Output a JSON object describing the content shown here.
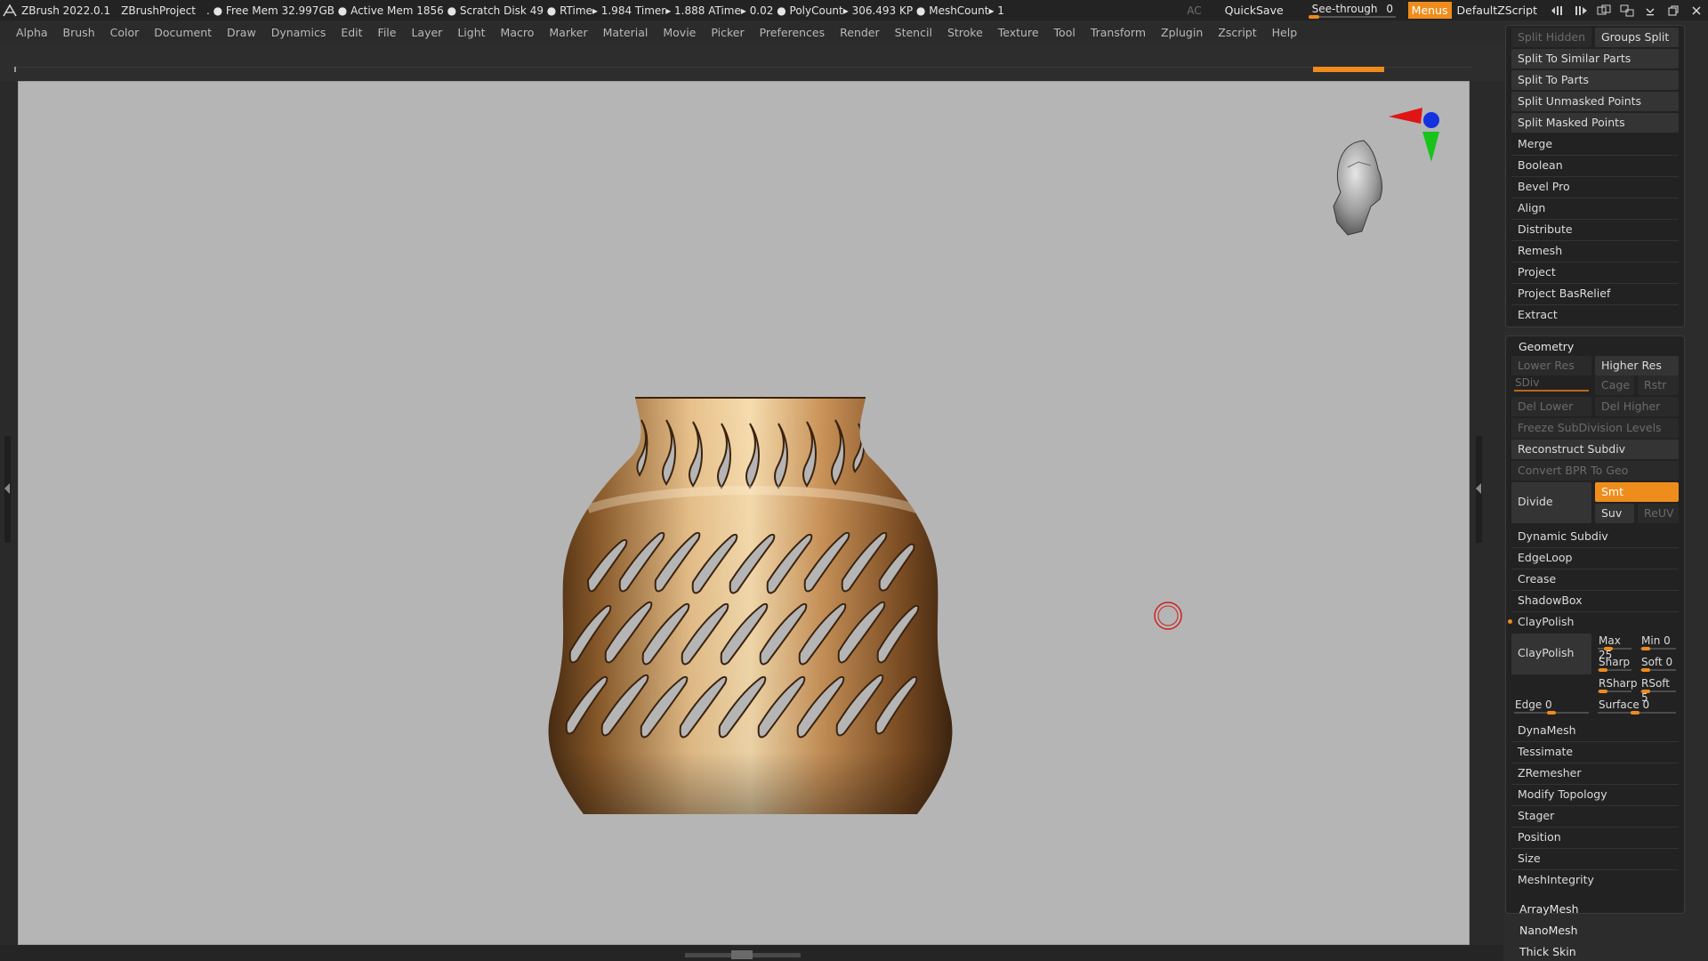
{
  "titlebar": {
    "app": "ZBrush 2022.0.1",
    "project": "ZBrushProject",
    "status": ". ● Free Mem 32.997GB ● Active Mem 1856 ● Scratch Disk 49 ● RTime▸ 1.984 Timer▸ 1.888 ATime▸ 0.02 ● PolyCount▸ 306.493 KP ● MeshCount▸ 1",
    "ac": "AC",
    "quicksave": "QuickSave",
    "see_through_label": "See-through",
    "see_through_value": "0",
    "menus": "Menus",
    "default_zscript": "DefaultZScript"
  },
  "menubar": [
    "Alpha",
    "Brush",
    "Color",
    "Document",
    "Draw",
    "Dynamics",
    "Edit",
    "File",
    "Layer",
    "Light",
    "Macro",
    "Marker",
    "Material",
    "Movie",
    "Picker",
    "Preferences",
    "Render",
    "Stencil",
    "Stroke",
    "Texture",
    "Tool",
    "Transform",
    "Zplugin",
    "Zscript",
    "Help"
  ],
  "subtool": {
    "split_hidden": "Split Hidden",
    "groups_split": "Groups Split",
    "split_similar": "Split To Similar Parts",
    "split_parts": "Split To Parts",
    "split_unmasked": "Split Unmasked Points",
    "split_masked": "Split Masked Points",
    "merge": "Merge",
    "boolean": "Boolean",
    "bevel_pro": "Bevel Pro",
    "align": "Align",
    "distribute": "Distribute",
    "remesh": "Remesh",
    "project": "Project",
    "project_basrelief": "Project BasRelief",
    "extract": "Extract"
  },
  "geometry": {
    "title": "Geometry",
    "lower_res": "Lower Res",
    "higher_res": "Higher Res",
    "sdiv": "SDiv",
    "cage": "Cage",
    "rstr": "Rstr",
    "del_lower": "Del Lower",
    "del_higher": "Del Higher",
    "freeze": "Freeze SubDivision Levels",
    "reconstruct": "Reconstruct Subdiv",
    "convert_bpr": "Convert BPR To Geo",
    "divide": "Divide",
    "smt": "Smt",
    "suv": "Suv",
    "reuv": "ReUV",
    "dynamic_subdiv": "Dynamic Subdiv",
    "edgeloop": "EdgeLoop",
    "crease": "Crease",
    "shadowbox": "ShadowBox",
    "claypolish_header": "ClayPolish",
    "claypolish_btn": "ClayPolish",
    "max": "Max 25",
    "min": "Min 0",
    "sharp": "Sharp",
    "soft": "Soft 0",
    "rsharp": "RSharp",
    "rsoft": "RSoft 5",
    "edge": "Edge 0",
    "surface": "Surface 0",
    "dynamesh": "DynaMesh",
    "tessimate": "Tessimate",
    "zremesher": "ZRemesher",
    "modify_topology": "Modify Topology",
    "stager": "Stager",
    "position": "Position",
    "size": "Size",
    "meshintegrity": "MeshIntegrity"
  },
  "more": {
    "arraymesh": "ArrayMesh",
    "nanomesh": "NanoMesh",
    "thick_skin": "Thick Skin"
  },
  "colors": {
    "accent": "#ef8d1c",
    "viewport_bg": "#b5b5b5",
    "vase_gold": "#c9955a"
  },
  "icons": [
    "zbrush-logo-icon",
    "head-navigator-icon",
    "gizmo-axes-icon",
    "brush-cursor-icon"
  ]
}
